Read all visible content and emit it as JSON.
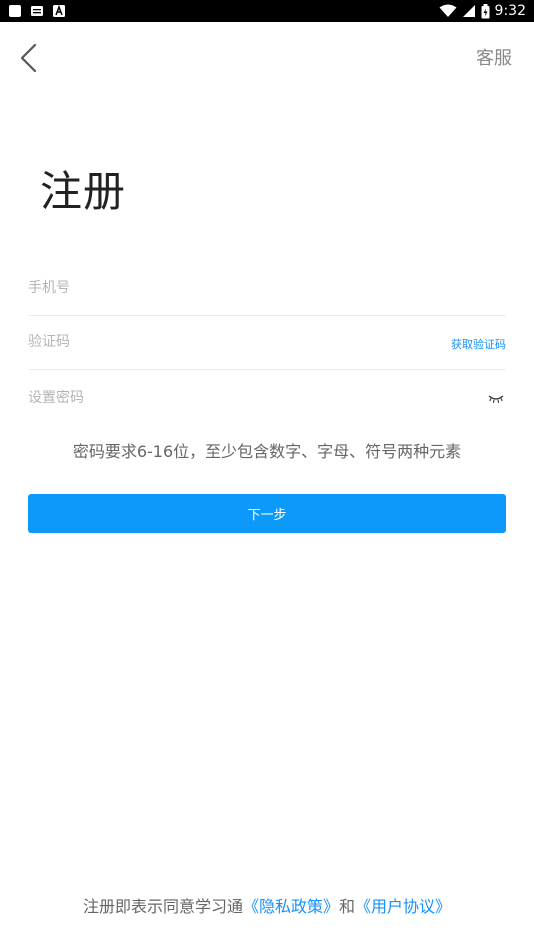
{
  "status_bar": {
    "time": "9:32",
    "icons": [
      "square-icon",
      "message-icon",
      "a-icon",
      "wifi-icon",
      "signal-icon",
      "battery-icon"
    ]
  },
  "nav": {
    "back_icon": "chevron-left-icon",
    "service_label": "客服"
  },
  "page": {
    "title": "注册"
  },
  "form": {
    "phone": {
      "placeholder": "手机号",
      "value": ""
    },
    "code": {
      "placeholder": "验证码",
      "value": "",
      "get_code_label": "获取验证码"
    },
    "password": {
      "placeholder": "设置密码",
      "value": "",
      "toggle_icon": "eye-closed-icon"
    },
    "hint": "密码要求6-16位，至少包含数字、字母、符号两种元素",
    "next_label": "下一步"
  },
  "agreement": {
    "prefix": "注册即表示同意学习通",
    "privacy": "《隐私政策》",
    "and": "和",
    "terms": "《用户协议》"
  },
  "colors": {
    "accent": "#0d99f9",
    "link": "#1890ff",
    "status_bar": "#000000"
  }
}
